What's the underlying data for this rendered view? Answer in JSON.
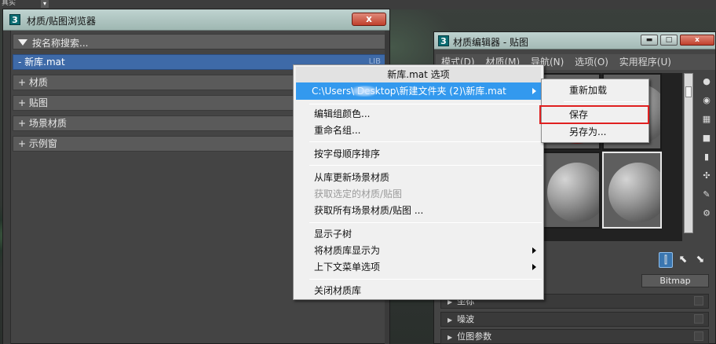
{
  "top_strip": {
    "text": "真实"
  },
  "browser": {
    "icon_label": "3",
    "title": "材质/贴图浏览器",
    "close_label": "x",
    "search_label": "按名称搜索...",
    "rows": [
      {
        "label": "- 新库.mat",
        "tag": "LIB"
      },
      {
        "label": "+ 材质"
      },
      {
        "label": "+ 贴图"
      },
      {
        "label": "+ 场景材质"
      },
      {
        "label": "+ 示例窗"
      }
    ]
  },
  "editor": {
    "icon_label": "3",
    "title": "材质编辑器 - 贴图",
    "close_label": "x",
    "menu": [
      "模式(D)",
      "材质(M)",
      "导航(N)",
      "选项(O)",
      "实用程序(U)"
    ],
    "bitmap_label": "Bitmap",
    "rollouts": [
      "坐标",
      "噪波",
      "位图参数"
    ]
  },
  "context_menu": {
    "header": "新库.mat 选项",
    "path_item": "C:\\Users\\       Desktop\\新建文件夹 (2)\\新库.mat",
    "items": [
      {
        "label": "编辑组颜色..."
      },
      {
        "label": "重命名组..."
      },
      {
        "label": "按字母顺序排序"
      },
      {
        "label": "从库更新场景材质"
      },
      {
        "label": "获取选定的材质/贴图"
      },
      {
        "label": "获取所有场景材质/贴图 ..."
      },
      {
        "label": "显示子树"
      },
      {
        "label": "将材质库显示为"
      },
      {
        "label": "上下文菜单选项"
      },
      {
        "label": "关闭材质库"
      }
    ]
  },
  "submenu": {
    "items": [
      {
        "label": "重新加载"
      },
      {
        "label": "保存"
      },
      {
        "label": "另存为..."
      }
    ]
  },
  "colors": {
    "highlight_blue": "#3399ee",
    "selected_row": "#3e6aa8",
    "annotation_red": "#e02020"
  }
}
